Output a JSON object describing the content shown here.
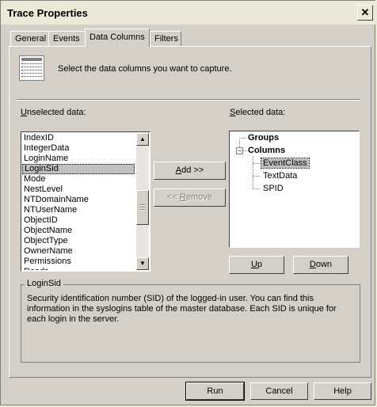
{
  "window": {
    "title": "Trace Properties",
    "close_glyph": "✕"
  },
  "tabs": [
    {
      "label": "General",
      "active": false
    },
    {
      "label": "Events",
      "active": false
    },
    {
      "label": "Data Columns",
      "active": true
    },
    {
      "label": "Filters",
      "active": false
    }
  ],
  "intro_text": "Select the data columns you want to capture.",
  "unselected": {
    "label_key": "U",
    "label_rest": "nselected data:",
    "items": [
      "IndexID",
      "IntegerData",
      "LoginName",
      "LoginSid",
      "Mode",
      "NestLevel",
      "NTDomainName",
      "NTUserName",
      "ObjectID",
      "ObjectName",
      "ObjectType",
      "OwnerName",
      "Permissions",
      "Reads"
    ],
    "selected_item": "LoginSid"
  },
  "selected": {
    "label_key": "S",
    "label_rest": "elected data:",
    "tree": {
      "groups_label": "Groups",
      "columns_label": "Columns",
      "expander_glyph": "−",
      "children": [
        "EventClass",
        "TextData",
        "SPID"
      ],
      "selected_child": "EventClass"
    }
  },
  "buttons": {
    "add": {
      "key": "A",
      "rest": "dd >>"
    },
    "remove": {
      "pre": "<< ",
      "key": "R",
      "rest": "emove"
    },
    "up": {
      "key": "U",
      "rest": "p"
    },
    "down": {
      "key": "D",
      "rest": "own"
    },
    "run": "Run",
    "cancel": "Cancel",
    "help": "Help"
  },
  "description": {
    "title": "LoginSid",
    "text": "Security identification number (SID) of the logged-in user. You can find this information in the syslogins table of the master database. Each SID is unique for each login in the server."
  },
  "scrollbar": {
    "up_glyph": "▲",
    "down_glyph": "▼"
  },
  "icons": {
    "data_columns": "data-columns-grid-icon"
  }
}
